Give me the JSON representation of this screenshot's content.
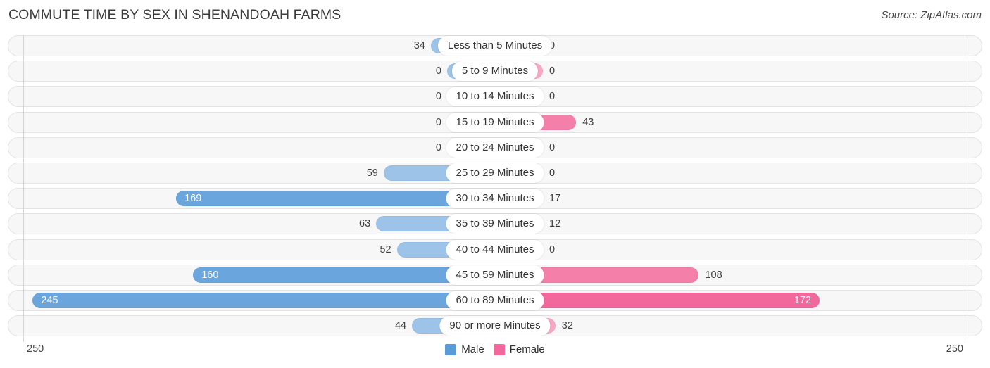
{
  "header": {
    "title": "COMMUTE TIME BY SEX IN SHENANDOAH FARMS",
    "source": "Source: ZipAtlas.com"
  },
  "legend": {
    "male_label": "Male",
    "female_label": "Female",
    "male_color": "#5b9bd5",
    "female_color": "#f3689c"
  },
  "axis": {
    "left_max_label": "250",
    "right_max_label": "250"
  },
  "chart_data": {
    "type": "bar",
    "title": "COMMUTE TIME BY SEX IN SHENANDOAH FARMS",
    "subtitle": "Source: ZipAtlas.com",
    "orientation": "horizontal-diverging",
    "xlabel": "",
    "ylabel": "",
    "xlim": [
      250,
      250
    ],
    "grid": true,
    "legend_position": "bottom-center",
    "categories": [
      "Less than 5 Minutes",
      "5 to 9 Minutes",
      "10 to 14 Minutes",
      "15 to 19 Minutes",
      "20 to 24 Minutes",
      "25 to 29 Minutes",
      "30 to 34 Minutes",
      "35 to 39 Minutes",
      "40 to 44 Minutes",
      "45 to 59 Minutes",
      "60 to 89 Minutes",
      "90 or more Minutes"
    ],
    "series": [
      {
        "name": "Male",
        "color": "#9dc3e9",
        "values": [
          34,
          0,
          0,
          0,
          0,
          59,
          169,
          63,
          52,
          160,
          245,
          44
        ]
      },
      {
        "name": "Female",
        "color": "#f9a8c2",
        "values": [
          0,
          0,
          0,
          43,
          0,
          0,
          17,
          12,
          0,
          108,
          172,
          32
        ]
      }
    ]
  },
  "rows": [
    {
      "label": "Less than 5 Minutes",
      "male": "34",
      "female": "0"
    },
    {
      "label": "5 to 9 Minutes",
      "male": "0",
      "female": "0"
    },
    {
      "label": "10 to 14 Minutes",
      "male": "0",
      "female": "0"
    },
    {
      "label": "15 to 19 Minutes",
      "male": "0",
      "female": "43"
    },
    {
      "label": "20 to 24 Minutes",
      "male": "0",
      "female": "0"
    },
    {
      "label": "25 to 29 Minutes",
      "male": "59",
      "female": "0"
    },
    {
      "label": "30 to 34 Minutes",
      "male": "169",
      "female": "17"
    },
    {
      "label": "35 to 39 Minutes",
      "male": "63",
      "female": "12"
    },
    {
      "label": "40 to 44 Minutes",
      "male": "52",
      "female": "0"
    },
    {
      "label": "45 to 59 Minutes",
      "male": "160",
      "female": "108"
    },
    {
      "label": "60 to 89 Minutes",
      "male": "245",
      "female": "172"
    },
    {
      "label": "90 or more Minutes",
      "male": "44",
      "female": "32"
    }
  ]
}
